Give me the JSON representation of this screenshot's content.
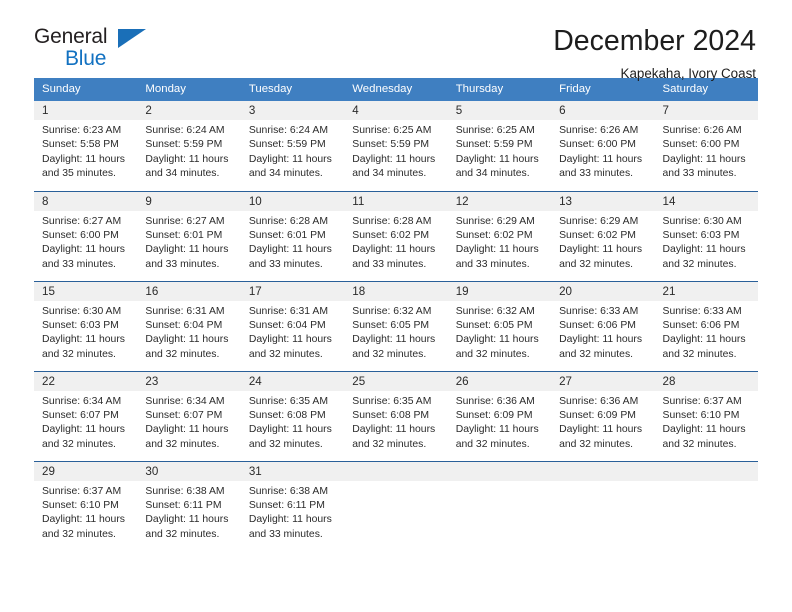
{
  "brand": {
    "name_top": "General",
    "name_bottom": "Blue",
    "accent_color": "#1a6fb8"
  },
  "header": {
    "title": "December 2024",
    "subtitle": "Kapekaha, Ivory Coast"
  },
  "calendar": {
    "header_bg": "#3f7fc1",
    "daynum_bg": "#f0f0f0",
    "row_divider_color": "#2a6099",
    "weekday_headers": [
      "Sunday",
      "Monday",
      "Tuesday",
      "Wednesday",
      "Thursday",
      "Friday",
      "Saturday"
    ],
    "labels": {
      "sunrise": "Sunrise:",
      "sunset": "Sunset:",
      "daylight": "Daylight:"
    },
    "weeks": [
      [
        {
          "day": "1",
          "sunrise": "Sunrise: 6:23 AM",
          "sunset": "Sunset: 5:58 PM",
          "daylight": "Daylight: 11 hours and 35 minutes."
        },
        {
          "day": "2",
          "sunrise": "Sunrise: 6:24 AM",
          "sunset": "Sunset: 5:59 PM",
          "daylight": "Daylight: 11 hours and 34 minutes."
        },
        {
          "day": "3",
          "sunrise": "Sunrise: 6:24 AM",
          "sunset": "Sunset: 5:59 PM",
          "daylight": "Daylight: 11 hours and 34 minutes."
        },
        {
          "day": "4",
          "sunrise": "Sunrise: 6:25 AM",
          "sunset": "Sunset: 5:59 PM",
          "daylight": "Daylight: 11 hours and 34 minutes."
        },
        {
          "day": "5",
          "sunrise": "Sunrise: 6:25 AM",
          "sunset": "Sunset: 5:59 PM",
          "daylight": "Daylight: 11 hours and 34 minutes."
        },
        {
          "day": "6",
          "sunrise": "Sunrise: 6:26 AM",
          "sunset": "Sunset: 6:00 PM",
          "daylight": "Daylight: 11 hours and 33 minutes."
        },
        {
          "day": "7",
          "sunrise": "Sunrise: 6:26 AM",
          "sunset": "Sunset: 6:00 PM",
          "daylight": "Daylight: 11 hours and 33 minutes."
        }
      ],
      [
        {
          "day": "8",
          "sunrise": "Sunrise: 6:27 AM",
          "sunset": "Sunset: 6:00 PM",
          "daylight": "Daylight: 11 hours and 33 minutes."
        },
        {
          "day": "9",
          "sunrise": "Sunrise: 6:27 AM",
          "sunset": "Sunset: 6:01 PM",
          "daylight": "Daylight: 11 hours and 33 minutes."
        },
        {
          "day": "10",
          "sunrise": "Sunrise: 6:28 AM",
          "sunset": "Sunset: 6:01 PM",
          "daylight": "Daylight: 11 hours and 33 minutes."
        },
        {
          "day": "11",
          "sunrise": "Sunrise: 6:28 AM",
          "sunset": "Sunset: 6:02 PM",
          "daylight": "Daylight: 11 hours and 33 minutes."
        },
        {
          "day": "12",
          "sunrise": "Sunrise: 6:29 AM",
          "sunset": "Sunset: 6:02 PM",
          "daylight": "Daylight: 11 hours and 33 minutes."
        },
        {
          "day": "13",
          "sunrise": "Sunrise: 6:29 AM",
          "sunset": "Sunset: 6:02 PM",
          "daylight": "Daylight: 11 hours and 32 minutes."
        },
        {
          "day": "14",
          "sunrise": "Sunrise: 6:30 AM",
          "sunset": "Sunset: 6:03 PM",
          "daylight": "Daylight: 11 hours and 32 minutes."
        }
      ],
      [
        {
          "day": "15",
          "sunrise": "Sunrise: 6:30 AM",
          "sunset": "Sunset: 6:03 PM",
          "daylight": "Daylight: 11 hours and 32 minutes."
        },
        {
          "day": "16",
          "sunrise": "Sunrise: 6:31 AM",
          "sunset": "Sunset: 6:04 PM",
          "daylight": "Daylight: 11 hours and 32 minutes."
        },
        {
          "day": "17",
          "sunrise": "Sunrise: 6:31 AM",
          "sunset": "Sunset: 6:04 PM",
          "daylight": "Daylight: 11 hours and 32 minutes."
        },
        {
          "day": "18",
          "sunrise": "Sunrise: 6:32 AM",
          "sunset": "Sunset: 6:05 PM",
          "daylight": "Daylight: 11 hours and 32 minutes."
        },
        {
          "day": "19",
          "sunrise": "Sunrise: 6:32 AM",
          "sunset": "Sunset: 6:05 PM",
          "daylight": "Daylight: 11 hours and 32 minutes."
        },
        {
          "day": "20",
          "sunrise": "Sunrise: 6:33 AM",
          "sunset": "Sunset: 6:06 PM",
          "daylight": "Daylight: 11 hours and 32 minutes."
        },
        {
          "day": "21",
          "sunrise": "Sunrise: 6:33 AM",
          "sunset": "Sunset: 6:06 PM",
          "daylight": "Daylight: 11 hours and 32 minutes."
        }
      ],
      [
        {
          "day": "22",
          "sunrise": "Sunrise: 6:34 AM",
          "sunset": "Sunset: 6:07 PM",
          "daylight": "Daylight: 11 hours and 32 minutes."
        },
        {
          "day": "23",
          "sunrise": "Sunrise: 6:34 AM",
          "sunset": "Sunset: 6:07 PM",
          "daylight": "Daylight: 11 hours and 32 minutes."
        },
        {
          "day": "24",
          "sunrise": "Sunrise: 6:35 AM",
          "sunset": "Sunset: 6:08 PM",
          "daylight": "Daylight: 11 hours and 32 minutes."
        },
        {
          "day": "25",
          "sunrise": "Sunrise: 6:35 AM",
          "sunset": "Sunset: 6:08 PM",
          "daylight": "Daylight: 11 hours and 32 minutes."
        },
        {
          "day": "26",
          "sunrise": "Sunrise: 6:36 AM",
          "sunset": "Sunset: 6:09 PM",
          "daylight": "Daylight: 11 hours and 32 minutes."
        },
        {
          "day": "27",
          "sunrise": "Sunrise: 6:36 AM",
          "sunset": "Sunset: 6:09 PM",
          "daylight": "Daylight: 11 hours and 32 minutes."
        },
        {
          "day": "28",
          "sunrise": "Sunrise: 6:37 AM",
          "sunset": "Sunset: 6:10 PM",
          "daylight": "Daylight: 11 hours and 32 minutes."
        }
      ],
      [
        {
          "day": "29",
          "sunrise": "Sunrise: 6:37 AM",
          "sunset": "Sunset: 6:10 PM",
          "daylight": "Daylight: 11 hours and 32 minutes."
        },
        {
          "day": "30",
          "sunrise": "Sunrise: 6:38 AM",
          "sunset": "Sunset: 6:11 PM",
          "daylight": "Daylight: 11 hours and 32 minutes."
        },
        {
          "day": "31",
          "sunrise": "Sunrise: 6:38 AM",
          "sunset": "Sunset: 6:11 PM",
          "daylight": "Daylight: 11 hours and 33 minutes."
        },
        {
          "day": "",
          "sunrise": "",
          "sunset": "",
          "daylight": ""
        },
        {
          "day": "",
          "sunrise": "",
          "sunset": "",
          "daylight": ""
        },
        {
          "day": "",
          "sunrise": "",
          "sunset": "",
          "daylight": ""
        },
        {
          "day": "",
          "sunrise": "",
          "sunset": "",
          "daylight": ""
        }
      ]
    ]
  }
}
